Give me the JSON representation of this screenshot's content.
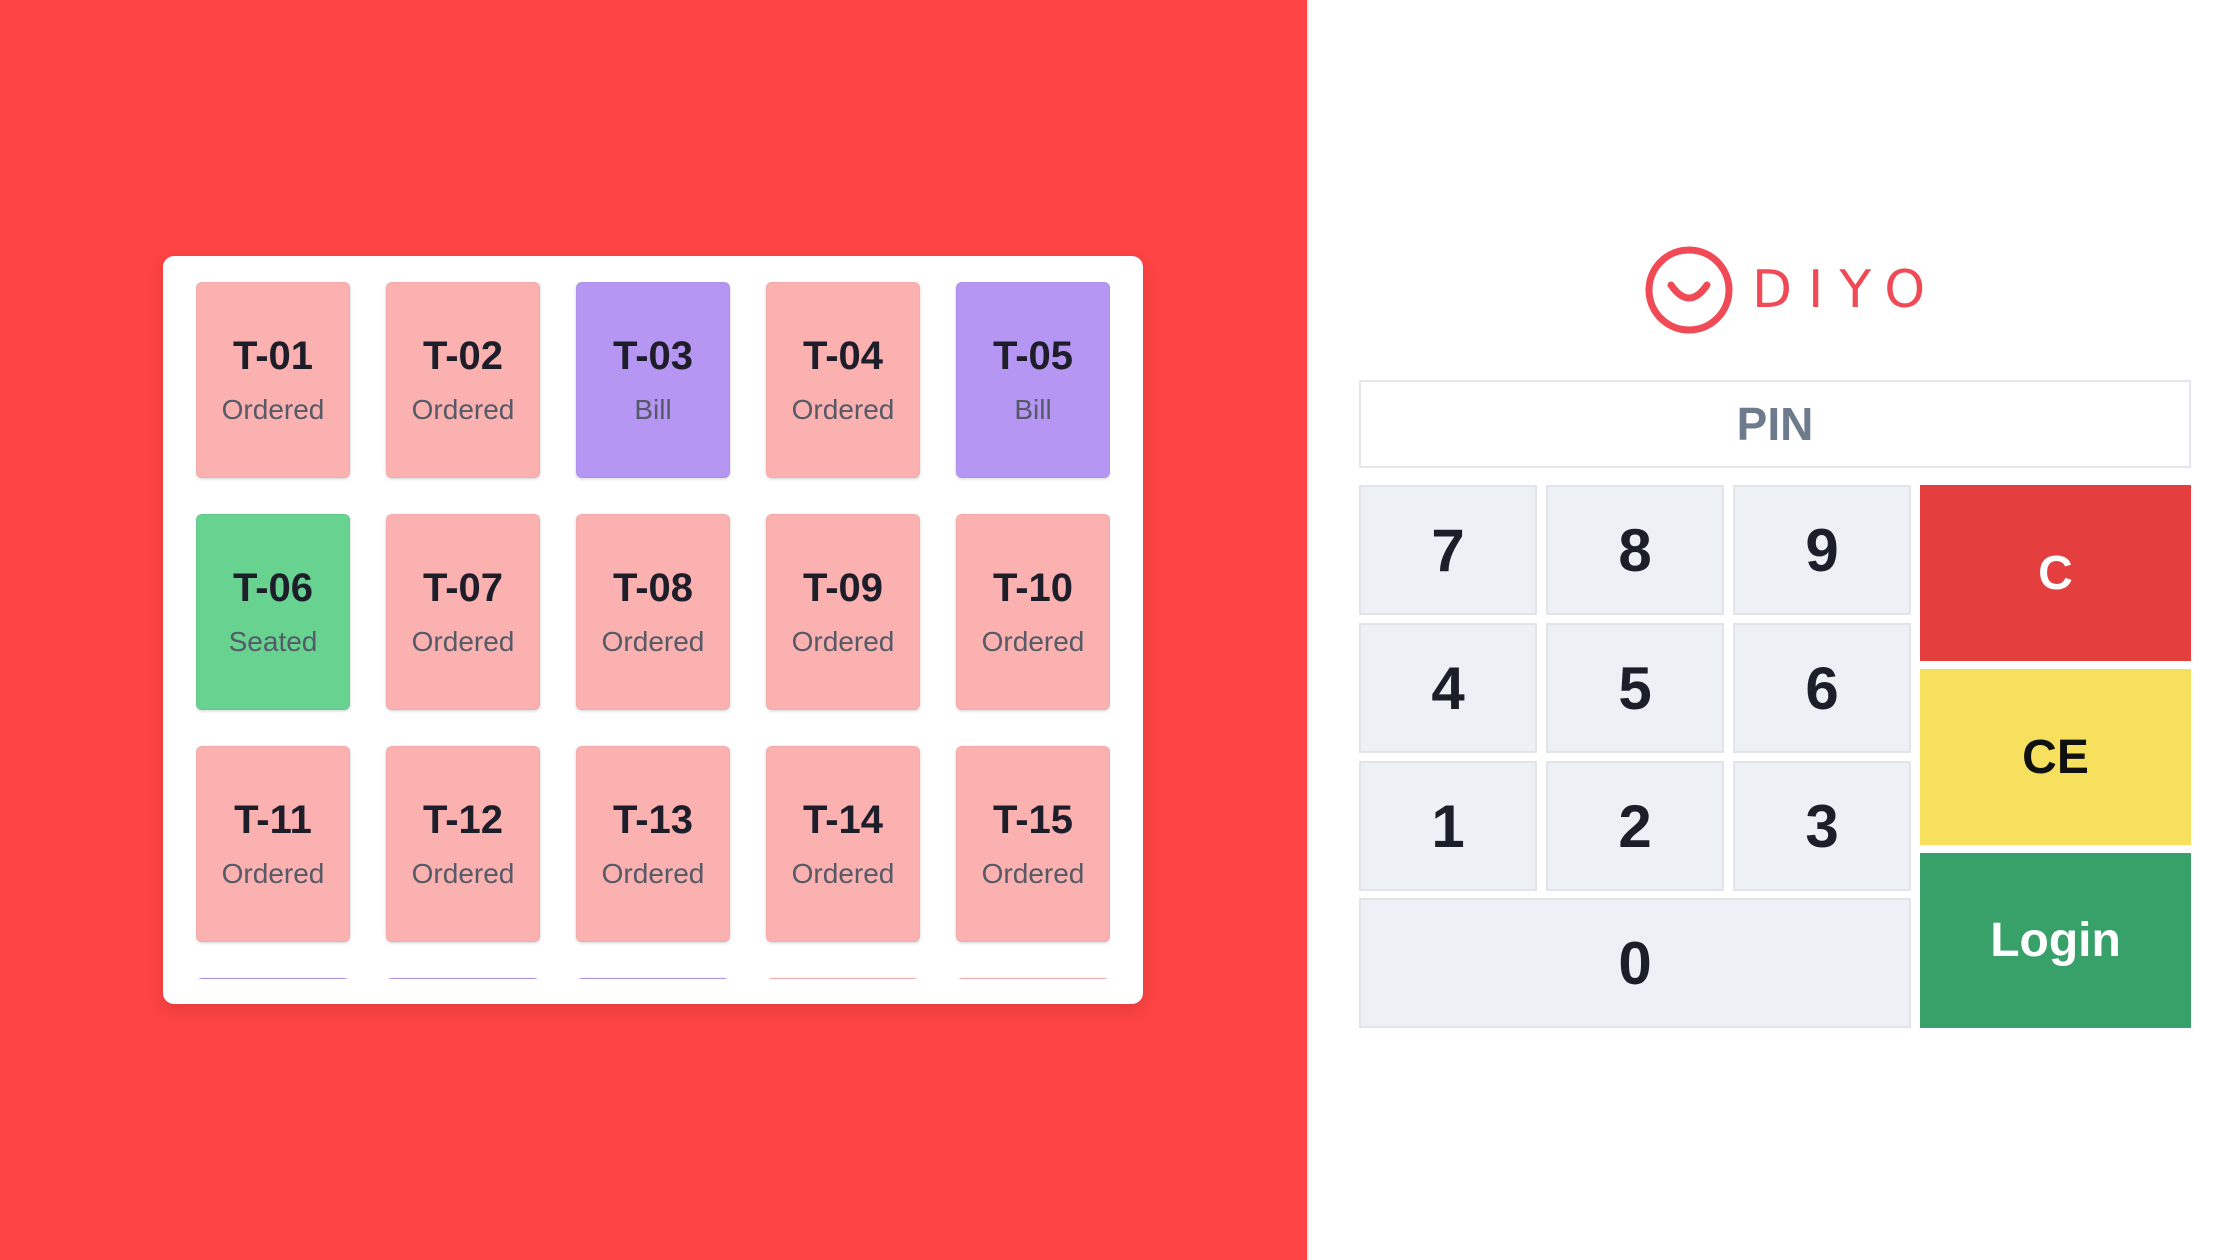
{
  "tables": [
    {
      "name": "T-01",
      "status": "Ordered",
      "color": "#fcb1b1"
    },
    {
      "name": "T-02",
      "status": "Ordered",
      "color": "#fcb1b1"
    },
    {
      "name": "T-03",
      "status": "Bill",
      "color": "#b596f3"
    },
    {
      "name": "T-04",
      "status": "Ordered",
      "color": "#fcb1b1"
    },
    {
      "name": "T-05",
      "status": "Bill",
      "color": "#b596f3"
    },
    {
      "name": "T-06",
      "status": "Seated",
      "color": "#68d391"
    },
    {
      "name": "T-07",
      "status": "Ordered",
      "color": "#fcb1b1"
    },
    {
      "name": "T-08",
      "status": "Ordered",
      "color": "#fcb1b1"
    },
    {
      "name": "T-09",
      "status": "Ordered",
      "color": "#fcb1b1"
    },
    {
      "name": "T-10",
      "status": "Ordered",
      "color": "#fcb1b1"
    },
    {
      "name": "T-11",
      "status": "Ordered",
      "color": "#fcb1b1"
    },
    {
      "name": "T-12",
      "status": "Ordered",
      "color": "#fcb1b1"
    },
    {
      "name": "T-13",
      "status": "Ordered",
      "color": "#fcb1b1"
    },
    {
      "name": "T-14",
      "status": "Ordered",
      "color": "#fcb1b1"
    },
    {
      "name": "T-15",
      "status": "Ordered",
      "color": "#fcb1b1"
    }
  ],
  "partial_row_colors": [
    "#b596f3",
    "#b596f3",
    "#b596f3",
    "#fcb1b1",
    "#fcb1b1"
  ],
  "brand": {
    "name": "DIYO",
    "logo_icon": "smiley-logo-icon",
    "color": "#ef4a56"
  },
  "login": {
    "pin_placeholder": "PIN",
    "keys": {
      "k7": "7",
      "k8": "8",
      "k9": "9",
      "k4": "4",
      "k5": "5",
      "k6": "6",
      "k1": "1",
      "k2": "2",
      "k3": "3",
      "k0": "0"
    },
    "clear_label": "C",
    "clear_entry_label": "CE",
    "login_label": "Login"
  },
  "colors": {
    "background_left": "#fe4444",
    "ordered": "#fcb1b1",
    "bill": "#b596f3",
    "seated": "#68d391",
    "clear": "#e53e3e",
    "clear_entry": "#f6e05e",
    "login": "#38a169"
  }
}
